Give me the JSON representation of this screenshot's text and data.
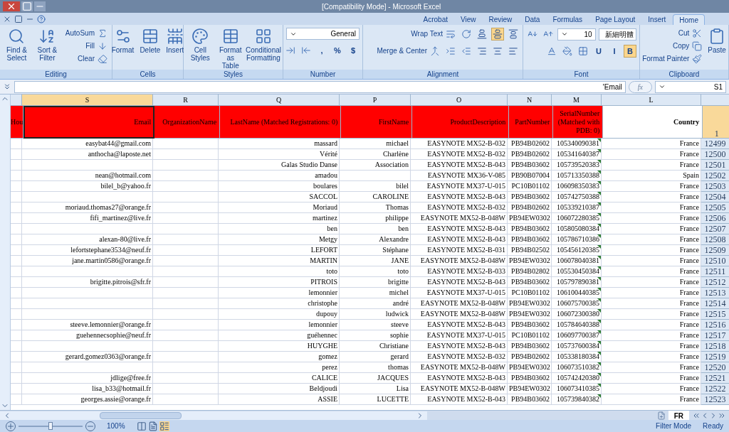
{
  "window": {
    "title": "[Compatibility Mode] - Microsoft Excel"
  },
  "ribbon_tabs": [
    {
      "label": "Acrobat",
      "selected": false
    },
    {
      "label": "View",
      "selected": false
    },
    {
      "label": "Review",
      "selected": false
    },
    {
      "label": "Data",
      "selected": false
    },
    {
      "label": "Formulas",
      "selected": false
    },
    {
      "label": "Page Layout",
      "selected": false
    },
    {
      "label": "Insert",
      "selected": false
    },
    {
      "label": "Home",
      "selected": true
    }
  ],
  "ribbon_groups": [
    {
      "name": "Editing",
      "controls": [
        {
          "kind": "large",
          "label": "Find & Select"
        },
        {
          "kind": "large",
          "label": "Sort & Filter"
        },
        {
          "kind": "small",
          "label": "AutoSum"
        },
        {
          "kind": "small",
          "label": "Fill"
        },
        {
          "kind": "small",
          "label": "Clear"
        }
      ]
    },
    {
      "name": "Cells",
      "controls": [
        {
          "kind": "large",
          "label": "Format"
        },
        {
          "kind": "large",
          "label": "Delete"
        },
        {
          "kind": "large",
          "label": "Insert"
        }
      ]
    },
    {
      "name": "Styles",
      "controls": [
        {
          "kind": "large",
          "label": "Cell Styles"
        },
        {
          "kind": "large",
          "label": "Format as Table"
        },
        {
          "kind": "large",
          "label": "Conditional Formatting"
        }
      ]
    },
    {
      "name": "Number",
      "controls": [
        {
          "kind": "dropdown",
          "label": "General"
        },
        {
          "kind": "icon"
        },
        {
          "kind": "icon"
        },
        {
          "kind": "toggle",
          "label": ",",
          "selected": false
        },
        {
          "kind": "toggle",
          "label": "%",
          "selected": false
        },
        {
          "kind": "toggle",
          "label": "$",
          "selected": false
        }
      ]
    },
    {
      "name": "Alignment",
      "controls": [
        {
          "kind": "small",
          "label": "Wrap Text"
        },
        {
          "kind": "icon"
        },
        {
          "kind": "toggle",
          "selected": false
        },
        {
          "kind": "toggle",
          "selected": true
        },
        {
          "kind": "toggle",
          "selected": false
        },
        {
          "kind": "small",
          "label": "Merge & Center"
        },
        {
          "kind": "icon"
        },
        {
          "kind": "icon"
        },
        {
          "kind": "toggle",
          "selected": false
        },
        {
          "kind": "toggle",
          "selected": false
        },
        {
          "kind": "toggle",
          "selected": false
        }
      ]
    },
    {
      "name": "Font",
      "controls": [
        {
          "kind": "icon"
        },
        {
          "kind": "icon"
        },
        {
          "kind": "dropdown",
          "label": "10"
        },
        {
          "kind": "dropdown",
          "label": "新細明體"
        },
        {
          "kind": "icon"
        },
        {
          "kind": "icon"
        },
        {
          "kind": "icon"
        },
        {
          "kind": "toggle",
          "label": "U",
          "selected": false
        },
        {
          "kind": "toggle",
          "label": "I",
          "selected": false
        },
        {
          "kind": "toggle",
          "label": "B",
          "selected": true
        }
      ]
    },
    {
      "name": "Clipboard",
      "controls": [
        {
          "kind": "small",
          "label": "Cut"
        },
        {
          "kind": "small",
          "label": "Copy"
        },
        {
          "kind": "small",
          "label": "Format Painter"
        },
        {
          "kind": "large",
          "label": "Paste"
        }
      ]
    }
  ],
  "formula_bar": {
    "value": "'Email",
    "fx": "fx",
    "name_box": "S1"
  },
  "columns": [
    {
      "letter": "S",
      "selected": true
    },
    {
      "letter": "R",
      "selected": false
    },
    {
      "letter": "Q",
      "selected": false
    },
    {
      "letter": "P",
      "selected": false
    },
    {
      "letter": "O",
      "selected": false
    },
    {
      "letter": "N",
      "selected": false
    },
    {
      "letter": "M",
      "selected": false
    },
    {
      "letter": "L",
      "selected": false
    }
  ],
  "header_row": {
    "cells": [
      "Hou",
      "Email",
      "OrganizationName",
      "LastName (Matched Registrations: 0)",
      "FirstName",
      "ProductDescription",
      "PartNumber",
      "SerialNumber (Matched with PDB: 0)",
      "Country"
    ],
    "number": "1"
  },
  "rows": [
    {
      "email": "easybat44@gmail.com",
      "last": "massard",
      "first": "michael",
      "description": "EASYNOTE MX52-B-032",
      "part": "PB94B02602",
      "serial": "105340090381",
      "country": "France",
      "number": "12499"
    },
    {
      "email": "anthocha@laposte.net",
      "last": "Vérité",
      "first": "Charlène",
      "description": "EASYNOTE MX52-B-032",
      "part": "PB94B02602",
      "serial": "105341640387",
      "country": "France",
      "number": "12500"
    },
    {
      "last": "Galas Studio Danse",
      "first": "Association",
      "description": "EASYNOTE MX52-B-043",
      "part": "PB94B03602",
      "serial": "105739520383",
      "country": "France",
      "number": "12501"
    },
    {
      "email": "nean@hotmail.com",
      "last": "amadou",
      "description": "EASYNOTE MX36-V-085",
      "part": "PB90B07004",
      "serial": "105713350388",
      "country": "Spain",
      "number": "12502"
    },
    {
      "email": "bilel_b@yahoo.fr",
      "last": "boulares",
      "first": "bilel",
      "description": "EASYNOTE MX37-U-015",
      "part": "PC10B01102",
      "serial": "106098350383",
      "country": "France",
      "number": "12503"
    },
    {
      "last": "SACCOL",
      "first": "CAROLINE",
      "description": "EASYNOTE MX52-B-043",
      "part": "PB94B03602",
      "serial": "105742750388",
      "country": "France",
      "number": "12504"
    },
    {
      "email": "moriaud.thomas27@orange.fr",
      "last": "Moriaud",
      "first": "Thomas",
      "description": "EASYNOTE MX52-B-032",
      "part": "PB94B02602",
      "serial": "105339210387",
      "country": "France",
      "number": "12505"
    },
    {
      "email": "fifi_martinez@live.fr",
      "last": "martinez",
      "first": "philippe",
      "description": "EASYNOTE MX52-B-048W",
      "part": "PB94EW0302",
      "serial": "106072280385",
      "country": "France",
      "number": "12506"
    },
    {
      "last": "ben",
      "first": "ben",
      "description": "EASYNOTE MX52-B-043",
      "part": "PB94B03602",
      "serial": "105805080384",
      "country": "France",
      "number": "12507"
    },
    {
      "email": "alexan-80@live.fr",
      "last": "Metgy",
      "first": "Alexandre",
      "description": "EASYNOTE MX52-B-043",
      "part": "PB94B03602",
      "serial": "105786710386",
      "country": "France",
      "number": "12508"
    },
    {
      "email": "lefortstephane3534@neuf.fr",
      "last": "LEFORT",
      "first": "Stéphane",
      "description": "EASYNOTE MX52-B-031",
      "part": "PB94B02502",
      "serial": "105456120385",
      "country": "France",
      "number": "12509"
    },
    {
      "email": "jane.martin0586@orange.fr",
      "last": "MARTIN",
      "first": "JANE",
      "description": "EASYNOTE MX52-B-048W",
      "part": "PB94EW0302",
      "serial": "106078040381",
      "country": "France",
      "number": "12510"
    },
    {
      "last": "toto",
      "first": "toto",
      "description": "EASYNOTE MX52-B-033",
      "part": "PB94B02802",
      "serial": "105530450384",
      "country": "France",
      "number": "12511"
    },
    {
      "email": "brigitte.pitrois@sfr.fr",
      "last": "PITROIS",
      "first": "brigitte",
      "description": "EASYNOTE MX52-B-043",
      "part": "PB94B03602",
      "serial": "105797890381",
      "country": "France",
      "number": "12512"
    },
    {
      "last": "lemonnier",
      "first": "michel",
      "description": "EASYNOTE MX37-U-015",
      "part": "PC10B01102",
      "serial": "106100440385",
      "country": "France",
      "number": "12513"
    },
    {
      "last": "christophe",
      "first": "andré",
      "description": "EASYNOTE MX52-B-048W",
      "part": "PB94EW0302",
      "serial": "106075700385",
      "country": "France",
      "number": "12514"
    },
    {
      "last": "dupouy",
      "first": "ludwick",
      "description": "EASYNOTE MX52-B-048W",
      "part": "PB94EW0302",
      "serial": "106072300380",
      "country": "France",
      "number": "12515"
    },
    {
      "email": "steeve.lemonnier@orange.fr",
      "last": "lemonnier",
      "first": "steeve",
      "description": "EASYNOTE MX52-B-043",
      "part": "PB94B03602",
      "serial": "105784640388",
      "country": "France",
      "number": "12516"
    },
    {
      "email": "guehennecsophie@neuf.fr",
      "last": "guéhennec",
      "first": "sophie",
      "description": "EASYNOTE MX37-U-015",
      "part": "PC10B01102",
      "serial": "106097700387",
      "country": "France",
      "number": "12517"
    },
    {
      "last": "HUYGHE",
      "first": "Christiane",
      "description": "EASYNOTE MX52-B-043",
      "part": "PB94B03602",
      "serial": "105737600384",
      "country": "France",
      "number": "12518"
    },
    {
      "email": "gerard.gomez0363@orange.fr",
      "last": "gomez",
      "first": "gerard",
      "description": "EASYNOTE MX52-B-032",
      "part": "PB94B02602",
      "serial": "105338180384",
      "country": "France",
      "number": "12519"
    },
    {
      "last": "perez",
      "first": "thomas",
      "description": "EASYNOTE MX52-B-048W",
      "part": "PB94EW0302",
      "serial": "106073510382",
      "country": "France",
      "number": "12520"
    },
    {
      "email": "jdlige@free.fr",
      "last": "CALICE",
      "first": "JACQUES",
      "description": "EASYNOTE MX52-B-043",
      "part": "PB94B03602",
      "serial": "105742420380",
      "country": "France",
      "number": "12521"
    },
    {
      "email": "lisa_b33@hotmail.fr",
      "last": "Beldjoudi",
      "first": "Lisa",
      "description": "EASYNOTE MX52-B-048W",
      "part": "PB94EW0302",
      "serial": "106073410385",
      "country": "France",
      "number": "12522"
    },
    {
      "email": "georges.assie@orange.fr",
      "last": "ASSIE",
      "first": "LUCETTE",
      "description": "EASYNOTE MX52-B-043",
      "part": "PB94B03602",
      "serial": "105739840382",
      "country": "France",
      "number": "12523"
    }
  ],
  "sheet_tabs": [
    {
      "label": "FR",
      "selected": true
    }
  ],
  "status_bar": {
    "zoom": {
      "level": 0.5,
      "label": "100%"
    },
    "items": [
      "Filter Mode",
      "Ready"
    ]
  }
}
